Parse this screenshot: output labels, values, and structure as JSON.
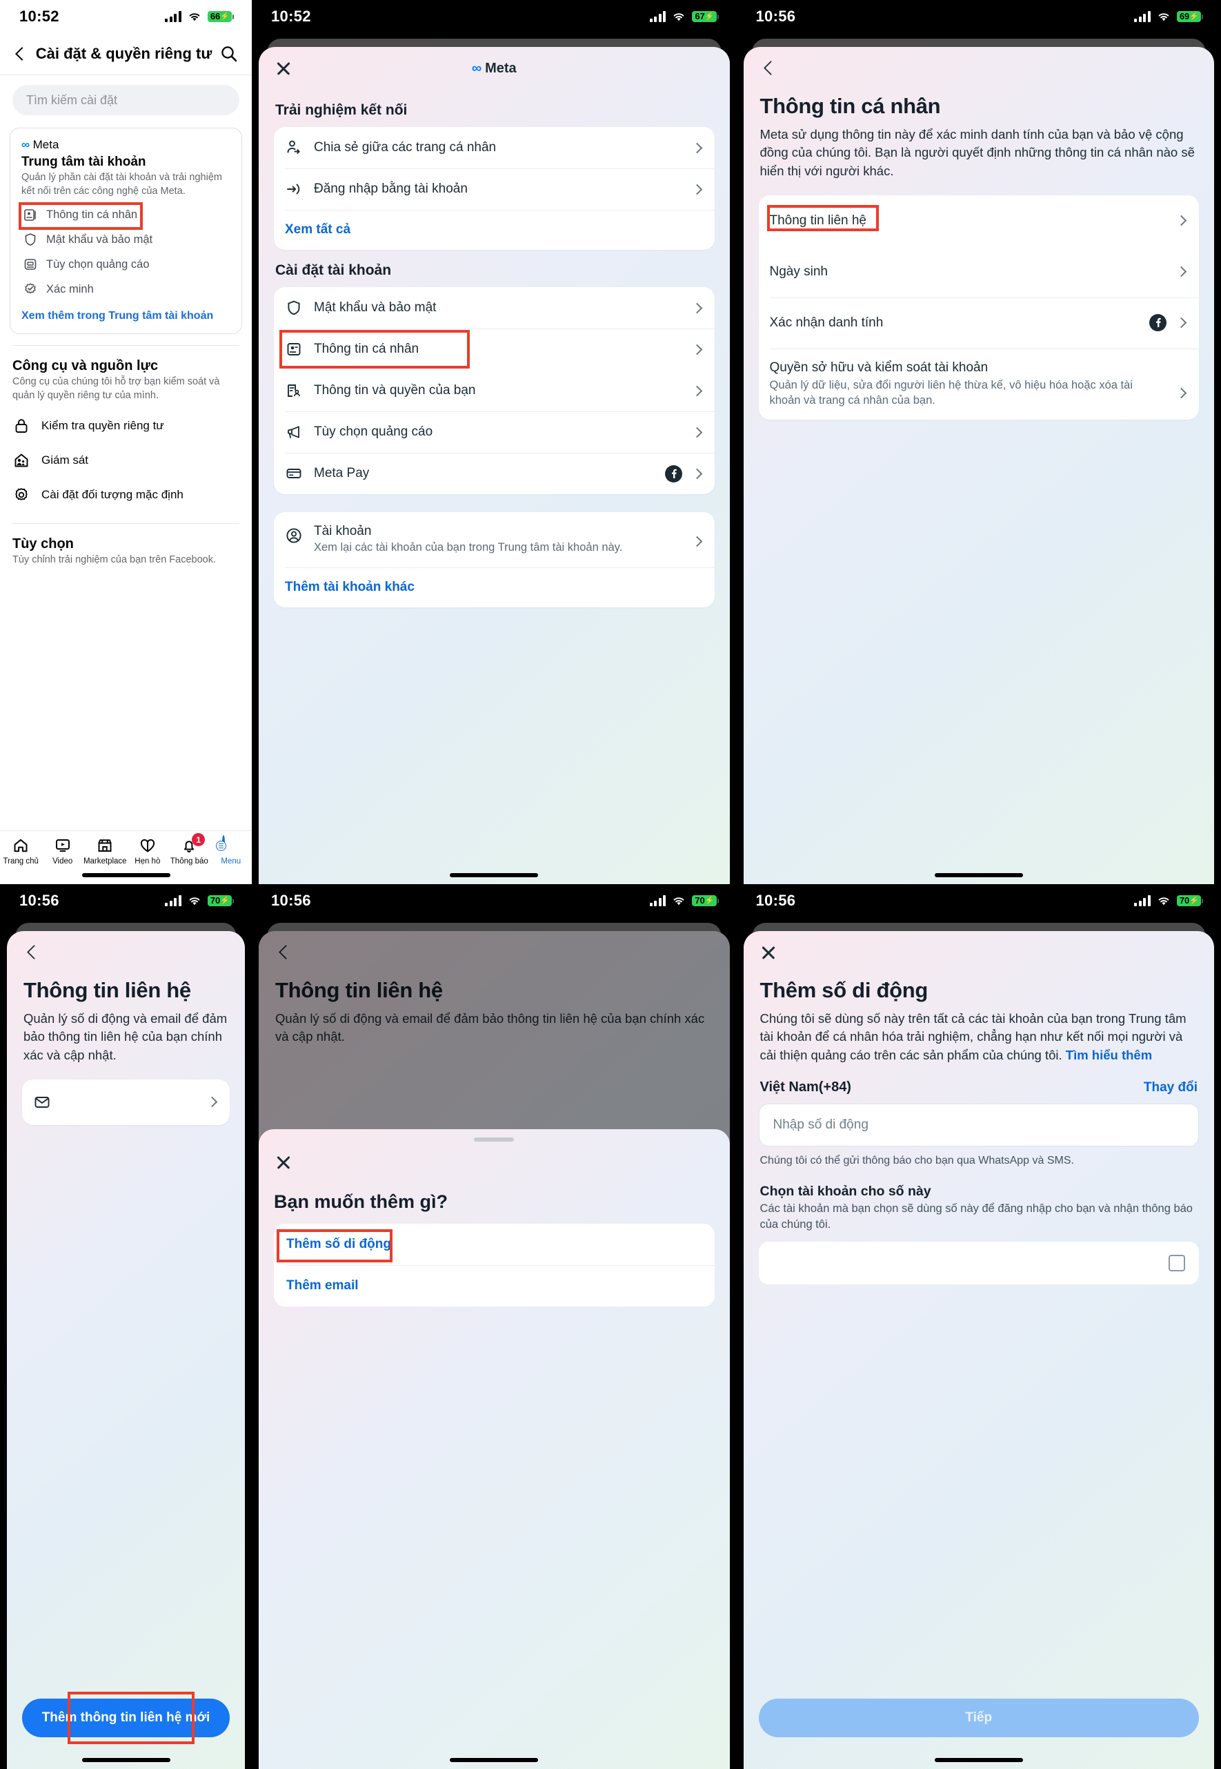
{
  "panel1": {
    "status": {
      "time": "10:52",
      "battery": "66"
    },
    "nav": {
      "title": "Cài đặt & quyền riêng tư",
      "back_icon": "back-chevron-icon",
      "search_icon": "search-icon"
    },
    "search": {
      "placeholder": "Tìm kiếm cài đặt"
    },
    "account_center": {
      "brand": "Meta",
      "title": "Trung tâm tài khoản",
      "desc": "Quản lý phần cài đặt tài khoản và trải nghiệm kết nối trên các công nghệ của Meta.",
      "items": [
        {
          "label": "Thông tin cá nhân",
          "icon": "id-card-icon",
          "highlighted": true
        },
        {
          "label": "Mật khẩu và bảo mật",
          "icon": "shield-icon",
          "highlighted": false
        },
        {
          "label": "Tùy chọn quảng cáo",
          "icon": "ad-screen-icon",
          "highlighted": false
        },
        {
          "label": "Xác minh",
          "icon": "verified-badge-icon",
          "highlighted": false
        }
      ],
      "link": "Xem thêm trong Trung tâm tài khoản"
    },
    "tools": {
      "title": "Công cụ và nguồn lực",
      "desc": "Công cụ của chúng tôi hỗ trợ bạn kiểm soát và quản lý quyền riêng tư của mình.",
      "items": [
        {
          "label": "Kiểm tra quyền riêng tư",
          "icon": "lock-icon"
        },
        {
          "label": "Giám sát",
          "icon": "supervision-house-icon"
        },
        {
          "label": "Cài đặt đối tượng mặc định",
          "icon": "gear-icon"
        }
      ]
    },
    "preferences": {
      "title": "Tùy chọn",
      "desc": "Tùy chỉnh trải nghiệm của bạn trên Facebook."
    },
    "tabbar": [
      {
        "label": "Trang chủ",
        "icon": "home-icon",
        "active": false,
        "badge": ""
      },
      {
        "label": "Video",
        "icon": "video-icon",
        "active": false,
        "badge": ""
      },
      {
        "label": "Marketplace",
        "icon": "marketplace-icon",
        "active": false,
        "badge": ""
      },
      {
        "label": "Hẹn hò",
        "icon": "dating-heart-icon",
        "active": false,
        "badge": ""
      },
      {
        "label": "Thông báo",
        "icon": "bell-icon",
        "active": false,
        "badge": "1"
      },
      {
        "label": "Menu",
        "icon": "avatar-menu-icon",
        "active": true,
        "badge": ""
      }
    ]
  },
  "panel2": {
    "status": {
      "time": "10:52",
      "battery": "67"
    },
    "header": {
      "brand": "Meta",
      "close_icon": "close-icon"
    },
    "section1": {
      "title": "Trải nghiệm kết nối",
      "items": [
        {
          "label": "Chia sẻ giữa các trang cá nhân",
          "icon": "person-share-icon"
        },
        {
          "label": "Đăng nhập bằng tài khoản",
          "icon": "login-arrow-icon"
        }
      ],
      "link": "Xem tất cả"
    },
    "section2": {
      "title": "Cài đặt tài khoản",
      "items": [
        {
          "label": "Mật khẩu và bảo mật",
          "icon": "shield-icon",
          "highlighted": false,
          "badge": ""
        },
        {
          "label": "Thông tin cá nhân",
          "icon": "id-card-icon",
          "highlighted": true,
          "badge": ""
        },
        {
          "label": "Thông tin và quyền của bạn",
          "icon": "doc-person-icon",
          "highlighted": false,
          "badge": ""
        },
        {
          "label": "Tùy chọn quảng cáo",
          "icon": "megaphone-icon",
          "highlighted": false,
          "badge": ""
        },
        {
          "label": "Meta Pay",
          "icon": "credit-card-icon",
          "highlighted": false,
          "badge": "facebook-icon"
        }
      ]
    },
    "section3": {
      "title": "Tài khoản",
      "subtitle": "Xem lại các tài khoản của bạn trong Trung tâm tài khoản này.",
      "icon": "account-circle-icon",
      "link": "Thêm tài khoản khác"
    }
  },
  "panel3": {
    "status": {
      "time": "10:56",
      "battery": "69"
    },
    "back_icon": "back-chevron-icon",
    "title": "Thông tin cá nhân",
    "desc": "Meta sử dụng thông tin này để xác minh danh tính của bạn và bảo vệ cộng đồng của chúng tôi. Bạn là người quyết định những thông tin cá nhân nào sẽ hiển thị với người khác.",
    "items": [
      {
        "label": "Thông tin liên hệ",
        "sub": "",
        "badge": "",
        "highlighted": true
      },
      {
        "label": "Ngày sinh",
        "sub": "",
        "badge": "",
        "highlighted": false
      },
      {
        "label": "Xác nhận danh tính",
        "sub": "",
        "badge": "facebook-icon",
        "highlighted": false
      },
      {
        "label": "Quyền sở hữu và kiểm soát tài khoản",
        "sub": "Quản lý dữ liệu, sửa đổi người liên hệ thừa kế, vô hiệu hóa hoặc xóa tài khoản và trang cá nhân của bạn.",
        "badge": "",
        "highlighted": false
      }
    ]
  },
  "panel4": {
    "status": {
      "time": "10:56",
      "battery": "70"
    },
    "back_icon": "back-chevron-icon",
    "title": "Thông tin liên hệ",
    "desc": "Quản lý số di động và email để đảm bảo thông tin liên hệ của bạn chính xác và cập nhật.",
    "row": {
      "icon": "envelope-icon",
      "label": ""
    },
    "cta": "Thêm thông tin liên hệ mới"
  },
  "panel5": {
    "status": {
      "time": "10:56",
      "battery": "70"
    },
    "back_icon": "back-chevron-icon",
    "bg_title": "Thông tin liên hệ",
    "bg_desc": "Quản lý số di động và email để đảm bảo thông tin liên hệ của bạn chính xác và cập nhật.",
    "sheet": {
      "close_icon": "close-icon",
      "title": "Bạn muốn thêm gì?",
      "options": [
        {
          "label": "Thêm số di động",
          "highlighted": true
        },
        {
          "label": "Thêm email",
          "highlighted": false
        }
      ]
    }
  },
  "panel6": {
    "status": {
      "time": "10:56",
      "battery": "70"
    },
    "close_icon": "close-icon",
    "title": "Thêm số di động",
    "desc": "Chúng tôi sẽ dùng số này trên tất cả các tài khoản của bạn trong Trung tâm tài khoản để cá nhân hóa trải nghiệm, chẳng hạn như kết nối mọi người và cải thiện quảng cáo trên các sản phẩm của chúng tôi. ",
    "desc_link": "Tìm hiểu thêm",
    "country": "Việt Nam(+84)",
    "change": "Thay đổi",
    "phone_placeholder": "Nhập số di động",
    "hint": "Chúng tôi có thể gửi thông báo cho bạn qua WhatsApp và SMS.",
    "choose_title": "Chọn tài khoản cho số này",
    "choose_desc": "Các tài khoản mà bạn chọn sẽ dùng số này để đăng nhập cho bạn và nhận thông báo của chúng tôi.",
    "cta": "Tiếp"
  },
  "colors": {
    "accent_blue": "#1877f2",
    "link_blue": "#0a67d3",
    "meta_blue": "#0081fb",
    "highlight_red": "#ea3e2a",
    "battery_green": "#30d158"
  }
}
